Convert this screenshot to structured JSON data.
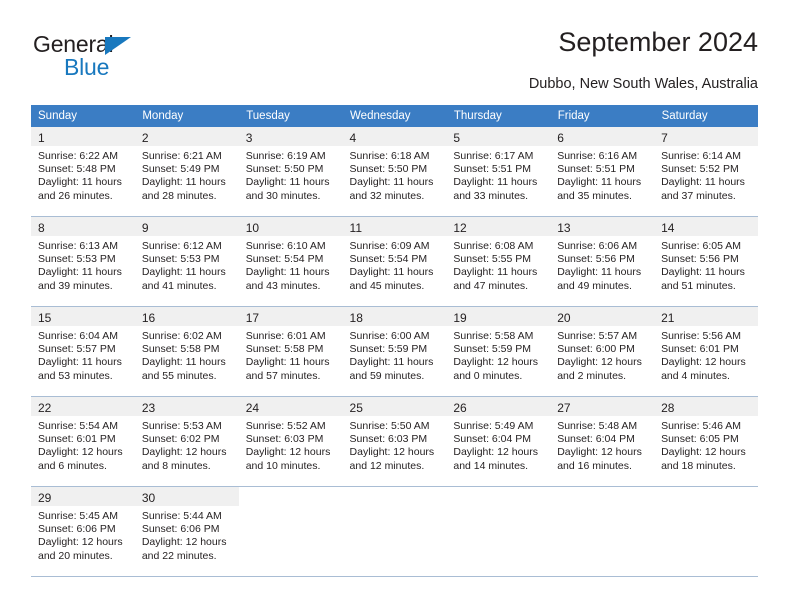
{
  "brand": {
    "name_part1": "General",
    "name_part2": "Blue",
    "accent_color": "#1878be"
  },
  "header": {
    "title": "September 2024",
    "subtitle": "Dubbo, New South Wales, Australia",
    "header_bg_color": "#3b7dc4",
    "daynum_bg_color": "#f0f0f0"
  },
  "calendar": {
    "weekday_headers": [
      "Sunday",
      "Monday",
      "Tuesday",
      "Wednesday",
      "Thursday",
      "Friday",
      "Saturday"
    ],
    "weeks": [
      [
        {
          "day": "1",
          "sunrise": "Sunrise: 6:22 AM",
          "sunset": "Sunset: 5:48 PM",
          "daylight": "Daylight: 11 hours and 26 minutes."
        },
        {
          "day": "2",
          "sunrise": "Sunrise: 6:21 AM",
          "sunset": "Sunset: 5:49 PM",
          "daylight": "Daylight: 11 hours and 28 minutes."
        },
        {
          "day": "3",
          "sunrise": "Sunrise: 6:19 AM",
          "sunset": "Sunset: 5:50 PM",
          "daylight": "Daylight: 11 hours and 30 minutes."
        },
        {
          "day": "4",
          "sunrise": "Sunrise: 6:18 AM",
          "sunset": "Sunset: 5:50 PM",
          "daylight": "Daylight: 11 hours and 32 minutes."
        },
        {
          "day": "5",
          "sunrise": "Sunrise: 6:17 AM",
          "sunset": "Sunset: 5:51 PM",
          "daylight": "Daylight: 11 hours and 33 minutes."
        },
        {
          "day": "6",
          "sunrise": "Sunrise: 6:16 AM",
          "sunset": "Sunset: 5:51 PM",
          "daylight": "Daylight: 11 hours and 35 minutes."
        },
        {
          "day": "7",
          "sunrise": "Sunrise: 6:14 AM",
          "sunset": "Sunset: 5:52 PM",
          "daylight": "Daylight: 11 hours and 37 minutes."
        }
      ],
      [
        {
          "day": "8",
          "sunrise": "Sunrise: 6:13 AM",
          "sunset": "Sunset: 5:53 PM",
          "daylight": "Daylight: 11 hours and 39 minutes."
        },
        {
          "day": "9",
          "sunrise": "Sunrise: 6:12 AM",
          "sunset": "Sunset: 5:53 PM",
          "daylight": "Daylight: 11 hours and 41 minutes."
        },
        {
          "day": "10",
          "sunrise": "Sunrise: 6:10 AM",
          "sunset": "Sunset: 5:54 PM",
          "daylight": "Daylight: 11 hours and 43 minutes."
        },
        {
          "day": "11",
          "sunrise": "Sunrise: 6:09 AM",
          "sunset": "Sunset: 5:54 PM",
          "daylight": "Daylight: 11 hours and 45 minutes."
        },
        {
          "day": "12",
          "sunrise": "Sunrise: 6:08 AM",
          "sunset": "Sunset: 5:55 PM",
          "daylight": "Daylight: 11 hours and 47 minutes."
        },
        {
          "day": "13",
          "sunrise": "Sunrise: 6:06 AM",
          "sunset": "Sunset: 5:56 PM",
          "daylight": "Daylight: 11 hours and 49 minutes."
        },
        {
          "day": "14",
          "sunrise": "Sunrise: 6:05 AM",
          "sunset": "Sunset: 5:56 PM",
          "daylight": "Daylight: 11 hours and 51 minutes."
        }
      ],
      [
        {
          "day": "15",
          "sunrise": "Sunrise: 6:04 AM",
          "sunset": "Sunset: 5:57 PM",
          "daylight": "Daylight: 11 hours and 53 minutes."
        },
        {
          "day": "16",
          "sunrise": "Sunrise: 6:02 AM",
          "sunset": "Sunset: 5:58 PM",
          "daylight": "Daylight: 11 hours and 55 minutes."
        },
        {
          "day": "17",
          "sunrise": "Sunrise: 6:01 AM",
          "sunset": "Sunset: 5:58 PM",
          "daylight": "Daylight: 11 hours and 57 minutes."
        },
        {
          "day": "18",
          "sunrise": "Sunrise: 6:00 AM",
          "sunset": "Sunset: 5:59 PM",
          "daylight": "Daylight: 11 hours and 59 minutes."
        },
        {
          "day": "19",
          "sunrise": "Sunrise: 5:58 AM",
          "sunset": "Sunset: 5:59 PM",
          "daylight": "Daylight: 12 hours and 0 minutes."
        },
        {
          "day": "20",
          "sunrise": "Sunrise: 5:57 AM",
          "sunset": "Sunset: 6:00 PM",
          "daylight": "Daylight: 12 hours and 2 minutes."
        },
        {
          "day": "21",
          "sunrise": "Sunrise: 5:56 AM",
          "sunset": "Sunset: 6:01 PM",
          "daylight": "Daylight: 12 hours and 4 minutes."
        }
      ],
      [
        {
          "day": "22",
          "sunrise": "Sunrise: 5:54 AM",
          "sunset": "Sunset: 6:01 PM",
          "daylight": "Daylight: 12 hours and 6 minutes."
        },
        {
          "day": "23",
          "sunrise": "Sunrise: 5:53 AM",
          "sunset": "Sunset: 6:02 PM",
          "daylight": "Daylight: 12 hours and 8 minutes."
        },
        {
          "day": "24",
          "sunrise": "Sunrise: 5:52 AM",
          "sunset": "Sunset: 6:03 PM",
          "daylight": "Daylight: 12 hours and 10 minutes."
        },
        {
          "day": "25",
          "sunrise": "Sunrise: 5:50 AM",
          "sunset": "Sunset: 6:03 PM",
          "daylight": "Daylight: 12 hours and 12 minutes."
        },
        {
          "day": "26",
          "sunrise": "Sunrise: 5:49 AM",
          "sunset": "Sunset: 6:04 PM",
          "daylight": "Daylight: 12 hours and 14 minutes."
        },
        {
          "day": "27",
          "sunrise": "Sunrise: 5:48 AM",
          "sunset": "Sunset: 6:04 PM",
          "daylight": "Daylight: 12 hours and 16 minutes."
        },
        {
          "day": "28",
          "sunrise": "Sunrise: 5:46 AM",
          "sunset": "Sunset: 6:05 PM",
          "daylight": "Daylight: 12 hours and 18 minutes."
        }
      ],
      [
        {
          "day": "29",
          "sunrise": "Sunrise: 5:45 AM",
          "sunset": "Sunset: 6:06 PM",
          "daylight": "Daylight: 12 hours and 20 minutes."
        },
        {
          "day": "30",
          "sunrise": "Sunrise: 5:44 AM",
          "sunset": "Sunset: 6:06 PM",
          "daylight": "Daylight: 12 hours and 22 minutes."
        },
        {
          "day": "",
          "sunrise": "",
          "sunset": "",
          "daylight": ""
        },
        {
          "day": "",
          "sunrise": "",
          "sunset": "",
          "daylight": ""
        },
        {
          "day": "",
          "sunrise": "",
          "sunset": "",
          "daylight": ""
        },
        {
          "day": "",
          "sunrise": "",
          "sunset": "",
          "daylight": ""
        },
        {
          "day": "",
          "sunrise": "",
          "sunset": "",
          "daylight": ""
        }
      ]
    ]
  }
}
